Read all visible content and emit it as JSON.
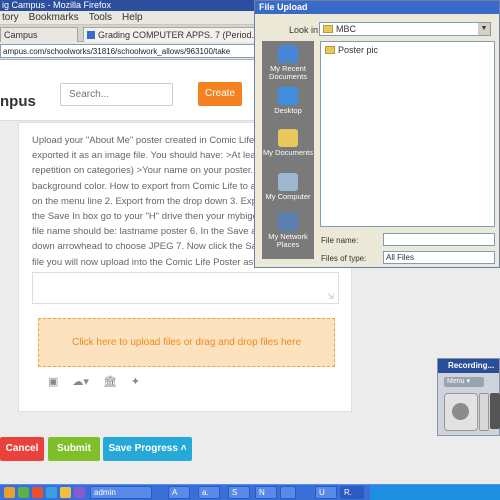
{
  "browser": {
    "title": "ig Campus - Mozilla Firefox",
    "menu": [
      "tory",
      "Bookmarks",
      "Tools",
      "Help"
    ],
    "tabs": [
      {
        "label": "Campus"
      },
      {
        "label": "Grading COMPUTER APPS. 7 (Period. 2..."
      }
    ],
    "url": "ampus.com/schoolworks/31816/schoolwork_allows/963100/take"
  },
  "site": {
    "logo": "npus",
    "search_placeholder": "Search...",
    "create_label": "Create"
  },
  "assignment": {
    "description_lines": [
      "Upload your \"About Me\" poster created in Comic Life E",
      "exported it as an image file. You should have: >At leas",
      "repetition on categories) >Your name on your poster. .",
      "background color. How to export from Comic Life to an",
      "on the menu line 2. Export from the drop down 3. Expc",
      "the Save In box go to your \"H\" drive then your mybigca",
      "file name should be: lastname poster 6. In the Save as",
      "down arrowhead to choose JPEG 7. Now click the Save",
      "file you will now upload into the Comic Life Poster assi"
    ],
    "dropzone_text": "Click here to upload files or drag and drop files here",
    "buttons": {
      "cancel": "Cancel",
      "submit": "Submit",
      "save_progress": "Save Progress ˄"
    }
  },
  "file_dialog": {
    "title": "File Upload",
    "look_in_label": "Look in:",
    "look_in_value": "MBC",
    "places": [
      "My Recent Documents",
      "Desktop",
      "My Documents",
      "My Computer",
      "My Network Places"
    ],
    "files": [
      "Poster pic"
    ],
    "file_name_label": "File name:",
    "file_name_value": "",
    "files_of_type_label": "Files of type:",
    "files_of_type_value": "All Files"
  },
  "recorder": {
    "title": "Recording...",
    "menu_label": "Menu"
  },
  "taskbar": {
    "tasks": [
      "admin",
      "A",
      "a.",
      "S",
      "N",
      "",
      "U",
      "R."
    ]
  }
}
